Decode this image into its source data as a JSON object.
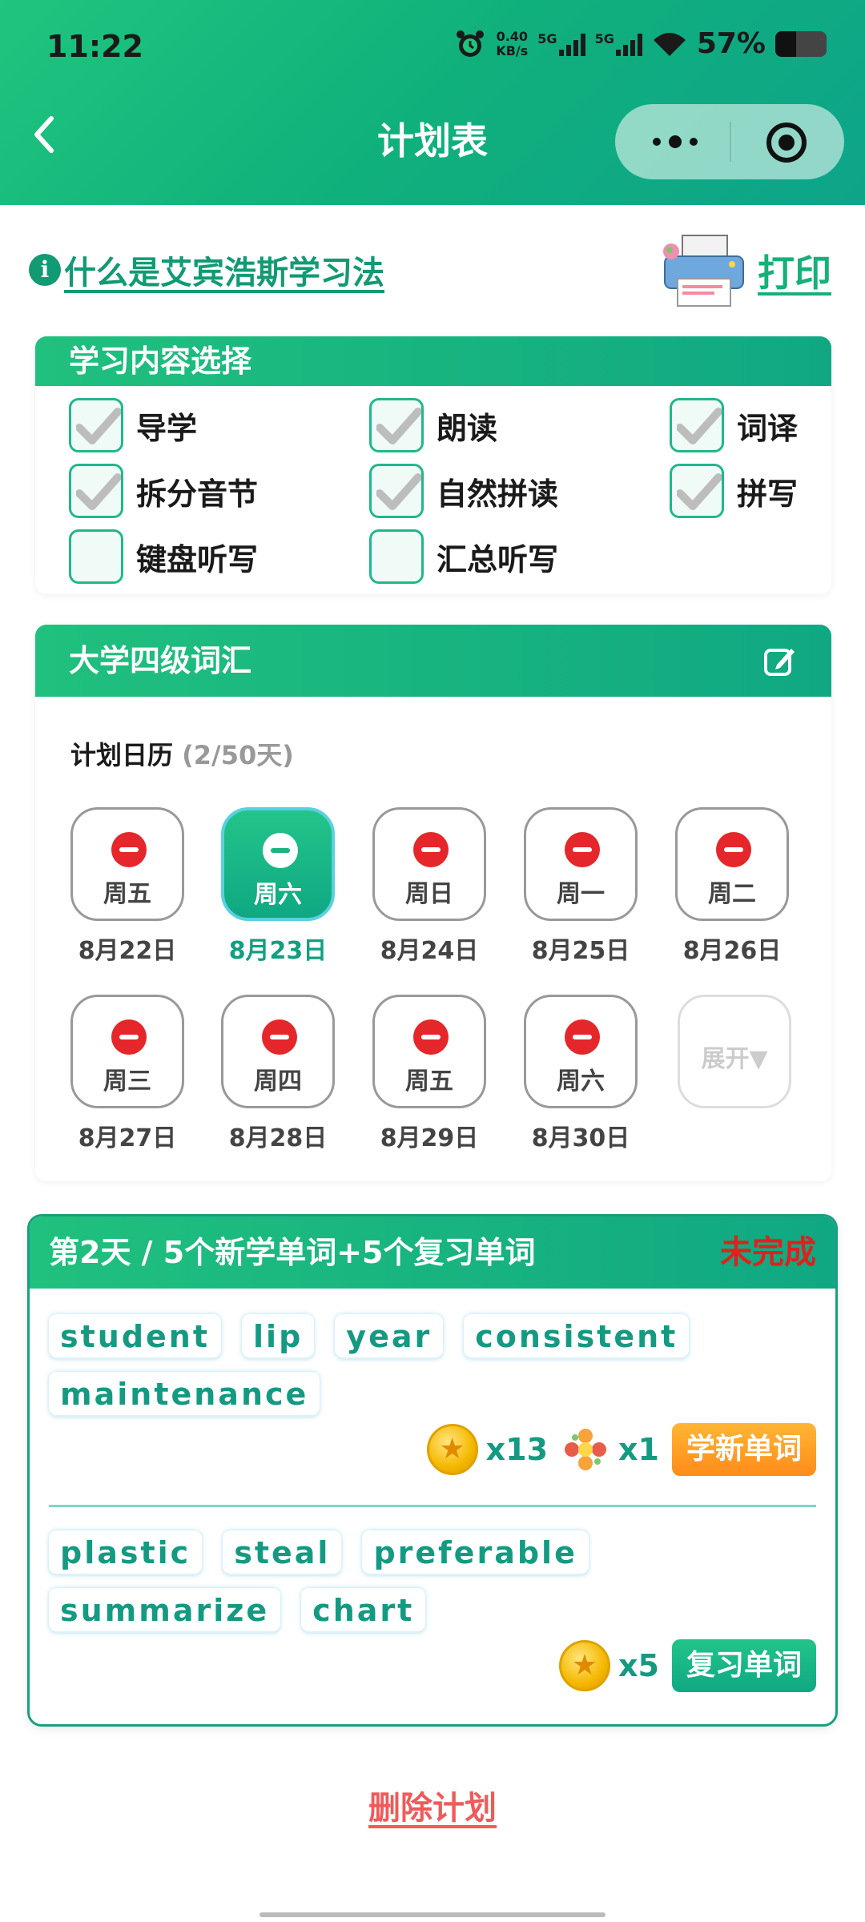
{
  "status_bar": {
    "time": "11:22",
    "net_speed_value": "0.40",
    "net_speed_unit": "KB/s",
    "signal1": "5G",
    "signal2": "5G",
    "battery": "57%",
    "icons": [
      "alarm-icon",
      "signal-icon",
      "signal-icon",
      "wifi-icon",
      "battery-icon"
    ]
  },
  "nav": {
    "title": "计划表",
    "back_icon": "chevron-left-icon",
    "more_icon": "more-dots-icon",
    "close_icon": "target-icon"
  },
  "top_links": {
    "info_icon_text": "i",
    "info_text": "什么是艾宾浩斯学习法",
    "print_label": "打印"
  },
  "content_selection": {
    "title": "学习内容选择",
    "options": [
      {
        "label": "导学",
        "checked": true
      },
      {
        "label": "朗读",
        "checked": true
      },
      {
        "label": "词译",
        "checked": true
      },
      {
        "label": "拆分音节",
        "checked": true
      },
      {
        "label": "自然拼读",
        "checked": true
      },
      {
        "label": "拼写",
        "checked": true
      },
      {
        "label": "键盘听写",
        "checked": false
      },
      {
        "label": "汇总听写",
        "checked": false
      }
    ]
  },
  "plan": {
    "title": "大学四级词汇",
    "calendar_label": "计划日历",
    "calendar_progress": "(2/50天)",
    "days": [
      {
        "weekday": "周五",
        "date": "8月22日",
        "active": false
      },
      {
        "weekday": "周六",
        "date": "8月23日",
        "active": true
      },
      {
        "weekday": "周日",
        "date": "8月24日",
        "active": false
      },
      {
        "weekday": "周一",
        "date": "8月25日",
        "active": false
      },
      {
        "weekday": "周二",
        "date": "8月26日",
        "active": false
      },
      {
        "weekday": "周三",
        "date": "8月27日",
        "active": false
      },
      {
        "weekday": "周四",
        "date": "8月28日",
        "active": false
      },
      {
        "weekday": "周五",
        "date": "8月29日",
        "active": false
      },
      {
        "weekday": "周六",
        "date": "8月30日",
        "active": false
      }
    ],
    "expand_label": "展开▼"
  },
  "day_detail": {
    "title": "第2天 / 5个新学单词+5个复习单词",
    "status": "未完成",
    "new_words": [
      "student",
      "lip",
      "year",
      "consistent",
      "maintenance"
    ],
    "new_coins": "x13",
    "new_flowers": "x1",
    "learn_button": "学新单词",
    "review_words": [
      "plastic",
      "steal",
      "preferable",
      "summarize",
      "chart"
    ],
    "review_coins": "x5",
    "review_button": "复习单词"
  },
  "footer": {
    "delete_label": "删除计划"
  },
  "colors": {
    "brand_green": "#10b07c",
    "accent_teal": "#159a82",
    "danger_red": "#e5262a",
    "orange": "#ff8c1a"
  }
}
